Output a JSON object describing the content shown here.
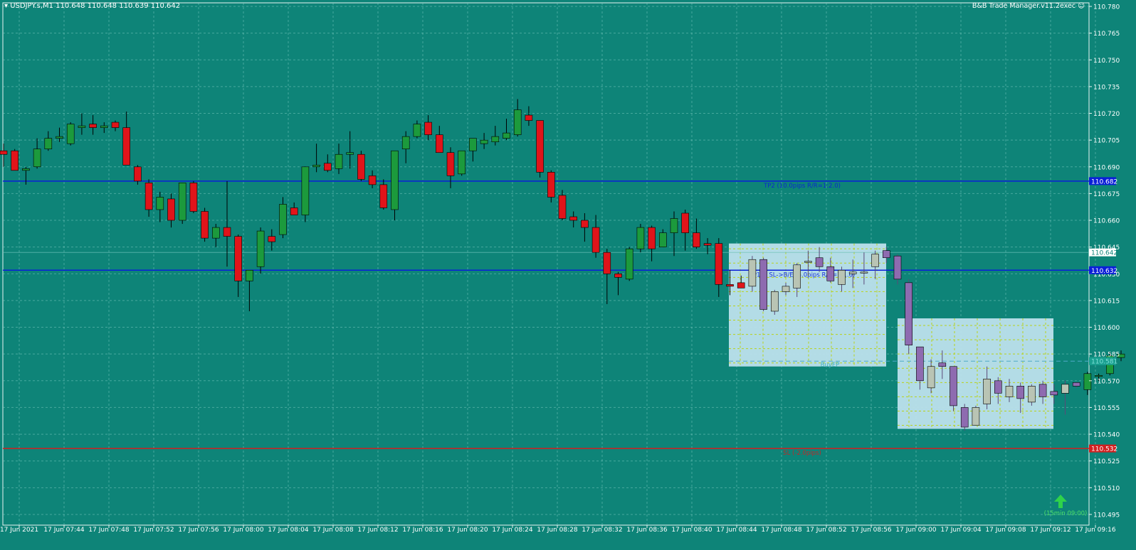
{
  "header": {
    "symbol_line": "USDJPY.s,M1  110.648 110.648 110.639 110.642",
    "ea_name": "B&B Trade Manager.v11.2exec",
    "ea_icon": "smiley-icon"
  },
  "colors": {
    "background": "#0e8478",
    "bull": "#1c9a3c",
    "bear": "#e0141a",
    "ghost_bull": "#b9c4b4",
    "ghost_bear": "#8e6bb0",
    "tp_line": "#0a1ed8",
    "sl_line": "#d02020",
    "zone_fill": "#bde0ec",
    "zone_grid": "#b9d21a",
    "arrow": "#2fd24a"
  },
  "chart_data": {
    "type": "candlestick",
    "symbol": "USDJPY.s",
    "timeframe": "M1",
    "ohlc_header": {
      "open": 110.648,
      "high": 110.648,
      "low": 110.639,
      "close": 110.642
    },
    "ylim": [
      110.489,
      110.782
    ],
    "y_ticks": [
      "110.780",
      "110.765",
      "110.750",
      "110.735",
      "110.720",
      "110.705",
      "110.690",
      "110.675",
      "110.660",
      "110.645",
      "110.630",
      "110.615",
      "110.600",
      "110.585",
      "110.570",
      "110.555",
      "110.540",
      "110.525",
      "110.510",
      "110.495"
    ],
    "x_ticks": [
      "17 Jun 2021",
      "17 Jun 07:44",
      "17 Jun 07:48",
      "17 Jun 07:52",
      "17 Jun 07:56",
      "17 Jun 08:00",
      "17 Jun 08:04",
      "17 Jun 08:08",
      "17 Jun 08:12",
      "17 Jun 08:16",
      "17 Jun 08:20",
      "17 Jun 08:24",
      "17 Jun 08:28",
      "17 Jun 08:32",
      "17 Jun 08:36",
      "17 Jun 08:40",
      "17 Jun 08:44",
      "17 Jun 08:48",
      "17 Jun 08:52",
      "17 Jun 08:56",
      "17 Jun 09:00",
      "17 Jun 09:04",
      "17 Jun 09:08",
      "17 Jun 09:12",
      "17 Jun 09:16"
    ],
    "candles": [
      {
        "o": 110.699,
        "h": 110.703,
        "l": 110.69,
        "c": 110.697
      },
      {
        "o": 110.699,
        "h": 110.7,
        "l": 110.688,
        "c": 110.688
      },
      {
        "o": 110.688,
        "h": 110.69,
        "l": 110.68,
        "c": 110.689
      },
      {
        "o": 110.69,
        "h": 110.706,
        "l": 110.689,
        "c": 110.7
      },
      {
        "o": 110.7,
        "h": 110.71,
        "l": 110.699,
        "c": 110.706
      },
      {
        "o": 110.706,
        "h": 110.712,
        "l": 110.704,
        "c": 110.707
      },
      {
        "o": 110.703,
        "h": 110.715,
        "l": 110.702,
        "c": 110.714
      },
      {
        "o": 110.712,
        "h": 110.72,
        "l": 110.708,
        "c": 110.713
      },
      {
        "o": 110.714,
        "h": 110.719,
        "l": 110.708,
        "c": 110.712
      },
      {
        "o": 110.712,
        "h": 110.715,
        "l": 110.709,
        "c": 110.713
      },
      {
        "o": 110.715,
        "h": 110.716,
        "l": 110.71,
        "c": 110.712
      },
      {
        "o": 110.712,
        "h": 110.721,
        "l": 110.692,
        "c": 110.691
      },
      {
        "o": 110.69,
        "h": 110.691,
        "l": 110.68,
        "c": 110.682
      },
      {
        "o": 110.681,
        "h": 110.683,
        "l": 110.662,
        "c": 110.666
      },
      {
        "o": 110.666,
        "h": 110.676,
        "l": 110.659,
        "c": 110.673
      },
      {
        "o": 110.672,
        "h": 110.675,
        "l": 110.656,
        "c": 110.66
      },
      {
        "o": 110.66,
        "h": 110.681,
        "l": 110.658,
        "c": 110.681
      },
      {
        "o": 110.681,
        "h": 110.682,
        "l": 110.664,
        "c": 110.665
      },
      {
        "o": 110.665,
        "h": 110.667,
        "l": 110.648,
        "c": 110.65
      },
      {
        "o": 110.65,
        "h": 110.658,
        "l": 110.645,
        "c": 110.656
      },
      {
        "o": 110.656,
        "h": 110.682,
        "l": 110.634,
        "c": 110.651
      },
      {
        "o": 110.651,
        "h": 110.652,
        "l": 110.617,
        "c": 110.626
      },
      {
        "o": 110.626,
        "h": 110.632,
        "l": 110.609,
        "c": 110.632
      },
      {
        "o": 110.634,
        "h": 110.656,
        "l": 110.63,
        "c": 110.654
      },
      {
        "o": 110.651,
        "h": 110.655,
        "l": 110.643,
        "c": 110.648
      },
      {
        "o": 110.652,
        "h": 110.673,
        "l": 110.65,
        "c": 110.669
      },
      {
        "o": 110.667,
        "h": 110.67,
        "l": 110.664,
        "c": 110.663
      },
      {
        "o": 110.663,
        "h": 110.69,
        "l": 110.659,
        "c": 110.69
      },
      {
        "o": 110.69,
        "h": 110.703,
        "l": 110.687,
        "c": 110.691
      },
      {
        "o": 110.692,
        "h": 110.697,
        "l": 110.687,
        "c": 110.688
      },
      {
        "o": 110.689,
        "h": 110.703,
        "l": 110.686,
        "c": 110.697
      },
      {
        "o": 110.697,
        "h": 110.71,
        "l": 110.689,
        "c": 110.698
      },
      {
        "o": 110.697,
        "h": 110.699,
        "l": 110.682,
        "c": 110.683
      },
      {
        "o": 110.685,
        "h": 110.688,
        "l": 110.678,
        "c": 110.68
      },
      {
        "o": 110.68,
        "h": 110.683,
        "l": 110.666,
        "c": 110.667
      },
      {
        "o": 110.666,
        "h": 110.686,
        "l": 110.66,
        "c": 110.699
      },
      {
        "o": 110.7,
        "h": 110.71,
        "l": 110.692,
        "c": 110.707
      },
      {
        "o": 110.707,
        "h": 110.716,
        "l": 110.706,
        "c": 110.714
      },
      {
        "o": 110.715,
        "h": 110.719,
        "l": 110.705,
        "c": 110.708
      },
      {
        "o": 110.708,
        "h": 110.713,
        "l": 110.698,
        "c": 110.698
      },
      {
        "o": 110.698,
        "h": 110.701,
        "l": 110.678,
        "c": 110.685
      },
      {
        "o": 110.686,
        "h": 110.69,
        "l": 110.685,
        "c": 110.699
      },
      {
        "o": 110.699,
        "h": 110.706,
        "l": 110.693,
        "c": 110.706
      },
      {
        "o": 110.703,
        "h": 110.709,
        "l": 110.7,
        "c": 110.705
      },
      {
        "o": 110.704,
        "h": 110.713,
        "l": 110.702,
        "c": 110.707
      },
      {
        "o": 110.706,
        "h": 110.717,
        "l": 110.705,
        "c": 110.709
      },
      {
        "o": 110.708,
        "h": 110.728,
        "l": 110.707,
        "c": 110.722
      },
      {
        "o": 110.719,
        "h": 110.724,
        "l": 110.713,
        "c": 110.716
      },
      {
        "o": 110.716,
        "h": 110.716,
        "l": 110.684,
        "c": 110.687
      },
      {
        "o": 110.687,
        "h": 110.688,
        "l": 110.67,
        "c": 110.673
      },
      {
        "o": 110.674,
        "h": 110.677,
        "l": 110.66,
        "c": 110.661
      },
      {
        "o": 110.662,
        "h": 110.665,
        "l": 110.656,
        "c": 110.66
      },
      {
        "o": 110.66,
        "h": 110.664,
        "l": 110.648,
        "c": 110.656
      },
      {
        "o": 110.656,
        "h": 110.663,
        "l": 110.639,
        "c": 110.642
      },
      {
        "o": 110.642,
        "h": 110.644,
        "l": 110.613,
        "c": 110.63
      },
      {
        "o": 110.63,
        "h": 110.631,
        "l": 110.618,
        "c": 110.628
      },
      {
        "o": 110.627,
        "h": 110.645,
        "l": 110.626,
        "c": 110.644
      },
      {
        "o": 110.644,
        "h": 110.658,
        "l": 110.642,
        "c": 110.656
      },
      {
        "o": 110.656,
        "h": 110.657,
        "l": 110.637,
        "c": 110.644
      },
      {
        "o": 110.645,
        "h": 110.655,
        "l": 110.645,
        "c": 110.653
      },
      {
        "o": 110.653,
        "h": 110.665,
        "l": 110.64,
        "c": 110.661
      },
      {
        "o": 110.664,
        "h": 110.666,
        "l": 110.643,
        "c": 110.653
      },
      {
        "o": 110.653,
        "h": 110.661,
        "l": 110.644,
        "c": 110.645
      },
      {
        "o": 110.647,
        "h": 110.65,
        "l": 110.641,
        "c": 110.646
      },
      {
        "o": 110.647,
        "h": 110.65,
        "l": 110.617,
        "c": 110.624
      },
      {
        "o": 110.624,
        "h": 110.632,
        "l": 110.618,
        "c": 110.623
      },
      {
        "o": 110.625,
        "h": 110.629,
        "l": 110.622,
        "c": 110.622
      }
    ],
    "projection_candles": [
      {
        "o": 110.623,
        "h": 110.64,
        "l": 110.62,
        "c": 110.638
      },
      {
        "o": 110.638,
        "h": 110.639,
        "l": 110.609,
        "c": 110.61
      },
      {
        "o": 110.609,
        "h": 110.621,
        "l": 110.607,
        "c": 110.62
      },
      {
        "o": 110.62,
        "h": 110.625,
        "l": 110.618,
        "c": 110.623
      },
      {
        "o": 110.622,
        "h": 110.636,
        "l": 110.617,
        "c": 110.635
      },
      {
        "o": 110.637,
        "h": 110.643,
        "l": 110.629,
        "c": 110.637
      },
      {
        "o": 110.639,
        "h": 110.645,
        "l": 110.631,
        "c": 110.634
      },
      {
        "o": 110.634,
        "h": 110.639,
        "l": 110.625,
        "c": 110.626
      },
      {
        "o": 110.624,
        "h": 110.634,
        "l": 110.62,
        "c": 110.632
      },
      {
        "o": 110.63,
        "h": 110.638,
        "l": 110.622,
        "c": 110.631
      },
      {
        "o": 110.631,
        "h": 110.642,
        "l": 110.624,
        "c": 110.631
      },
      {
        "o": 110.634,
        "h": 110.643,
        "l": 110.627,
        "c": 110.641
      },
      {
        "o": 110.643,
        "h": 110.645,
        "l": 110.636,
        "c": 110.639
      },
      {
        "o": 110.64,
        "h": 110.641,
        "l": 110.624,
        "c": 110.627
      },
      {
        "o": 110.625,
        "h": 110.627,
        "l": 110.585,
        "c": 110.59
      },
      {
        "o": 110.589,
        "h": 110.589,
        "l": 110.565,
        "c": 110.57
      },
      {
        "o": 110.566,
        "h": 110.582,
        "l": 110.563,
        "c": 110.578
      },
      {
        "o": 110.58,
        "h": 110.587,
        "l": 110.571,
        "c": 110.578
      },
      {
        "o": 110.578,
        "h": 110.578,
        "l": 110.553,
        "c": 110.556
      },
      {
        "o": 110.555,
        "h": 110.557,
        "l": 110.542,
        "c": 110.544
      },
      {
        "o": 110.545,
        "h": 110.556,
        "l": 110.545,
        "c": 110.555
      },
      {
        "o": 110.557,
        "h": 110.578,
        "l": 110.554,
        "c": 110.571
      },
      {
        "o": 110.57,
        "h": 110.572,
        "l": 110.557,
        "c": 110.563
      },
      {
        "o": 110.561,
        "h": 110.571,
        "l": 110.558,
        "c": 110.567
      },
      {
        "o": 110.567,
        "h": 110.569,
        "l": 110.552,
        "c": 110.56
      },
      {
        "o": 110.558,
        "h": 110.568,
        "l": 110.556,
        "c": 110.567
      },
      {
        "o": 110.568,
        "h": 110.57,
        "l": 110.557,
        "c": 110.561
      },
      {
        "o": 110.564,
        "h": 110.568,
        "l": 110.557,
        "c": 110.562
      },
      {
        "o": 110.563,
        "h": 110.57,
        "l": 110.551,
        "c": 110.568
      },
      {
        "o": 110.569,
        "h": 110.569,
        "l": 110.566,
        "c": 110.567
      }
    ],
    "tail_candles": [
      {
        "o": 110.565,
        "h": 110.575,
        "l": 110.562,
        "c": 110.574
      },
      {
        "o": 110.573,
        "h": 110.574,
        "l": 110.57,
        "c": 110.573
      },
      {
        "o": 110.574,
        "h": 110.586,
        "l": 110.573,
        "c": 110.584
      },
      {
        "o": 110.583,
        "h": 110.587,
        "l": 110.581,
        "c": 110.585
      }
    ],
    "levels": [
      {
        "name": "TP2",
        "price": 110.682,
        "tag": "110.682",
        "label": "TP2 (10.0pips R/R=1:2.0)",
        "color": "#0a1ed8"
      },
      {
        "name": "TP1",
        "price": 110.632,
        "tag": "110.632",
        "label": "TP1 & SL->B/E (5.0pips R/R=1:1.0)",
        "color": "#0a1ed8"
      },
      {
        "name": "SL",
        "price": 110.532,
        "tag": "110.532",
        "label": "SL (-2.0pips)",
        "color": "#d02020"
      }
    ],
    "entry": {
      "price": 110.581,
      "label": "BuyEP",
      "tag": "110.581"
    },
    "current_price": {
      "price": 110.642,
      "tag": "110.642"
    },
    "zones": [
      {
        "x_from": "17 Jun 08:44",
        "x_to": "17 Jun 08:58",
        "y_top": 110.647,
        "y_bottom": 110.578
      },
      {
        "x_from": "17 Jun 09:00",
        "x_to": "17 Jun 09:14",
        "y_top": 110.605,
        "y_bottom": 110.543
      }
    ],
    "signal": {
      "icon": "up-arrow-icon",
      "label": "(15min 09:00)"
    }
  }
}
